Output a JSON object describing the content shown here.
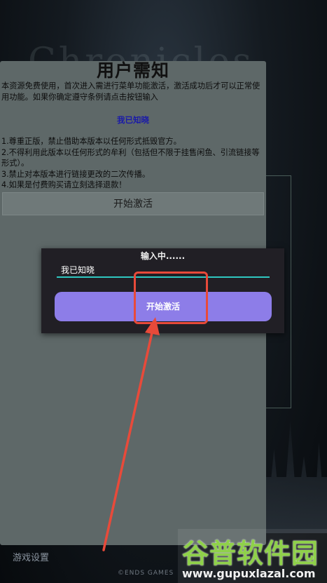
{
  "background": {
    "title": "Chronicles",
    "bottom_left": "游戏设置",
    "bottom_center": "©ENDS GAMES"
  },
  "notice": {
    "title": "用户需知",
    "intro": "本资源免费使用，首次进入需进行菜单功能激活，激活成功后才可以正常使用功能。如果你确定遵守条例请点击按钮输入",
    "link": "我已知晓",
    "rules": [
      "1.尊重正版，禁止借助本版本以任何形式抵毁官方。",
      "2.不得利用此版本以任何形式的牟利（包括但不限于挂售闲鱼、引流链接等形式）。",
      "3.禁止对本版本进行链接更改的二次传播。",
      "4.如果是付费购买请立刻选择退款！"
    ],
    "activate_label": "开始激活"
  },
  "dialog": {
    "title": "输入中......",
    "input_value": "我已知晓",
    "button_label": "开始激活"
  },
  "watermark": {
    "logo": "谷普软件园",
    "url": "www.gupuxlazal.com"
  },
  "colors": {
    "dialog_button": "#8d7de8",
    "input_underline": "#2fc7c0",
    "annotation": "#e84a3a",
    "watermark_green": "#8fd14a"
  }
}
